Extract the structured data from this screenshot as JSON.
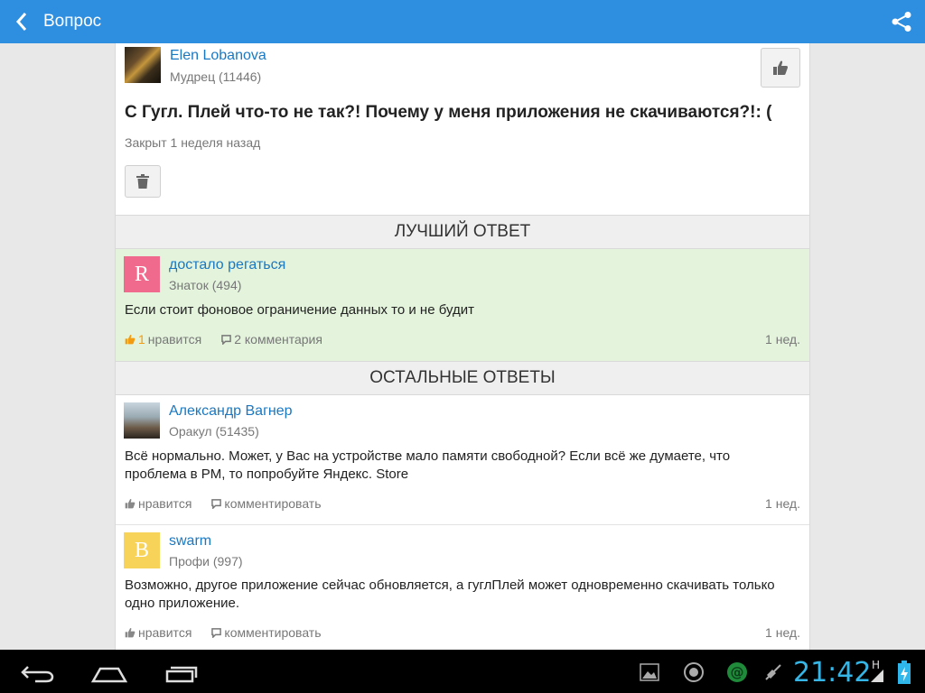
{
  "appbar": {
    "title": "Вопрос"
  },
  "question": {
    "author": {
      "name": "Elen Lobanova",
      "rank": "Мудрец (11446)"
    },
    "title": "С Гугл. Плей что-то не так?! Почему у меня приложения не скачиваются?!: (",
    "status": "Закрыт 1 неделя назад"
  },
  "best_answer": {
    "header": "ЛУЧШИЙ ОТВЕТ",
    "author": {
      "name": "достало регаться",
      "rank": "Знаток (494)",
      "avatar_letter": "R"
    },
    "text": "Если стоит фоновое ограничение данных то и не будит",
    "likes": "1",
    "likes_label": "нравится",
    "comments": "2 комментария",
    "age": "1 нед."
  },
  "other_answers": {
    "header": "ОСТАЛЬНЫЕ ОТВЕТЫ",
    "items": [
      {
        "author": {
          "name": "Александр Вагнер",
          "rank": "Оракул (51435)"
        },
        "text": "Всё нормально. Может, у Вас на устройстве мало памяти свободной? Если всё же думаете, что проблема в PM, то попробуйте Яндекс. Store",
        "like_label": "нравится",
        "comment_label": "комментировать",
        "age": "1 нед."
      },
      {
        "author": {
          "name": "swarm",
          "rank": "Профи (997)",
          "avatar_letter": "B"
        },
        "text": "Возможно, другое приложение сейчас обновляется, а гуглПлей может одновременно скачивать только одно приложение.",
        "like_label": "нравится",
        "comment_label": "комментировать",
        "age": "1 нед."
      }
    ]
  },
  "system": {
    "clock": "21:42",
    "network_letter": "H"
  },
  "colors": {
    "appbar": "#2e8ee0",
    "link": "#1a78c2",
    "best_bg": "#e3f3dc",
    "like_accent": "#f39c12",
    "clock": "#35b6e6"
  }
}
